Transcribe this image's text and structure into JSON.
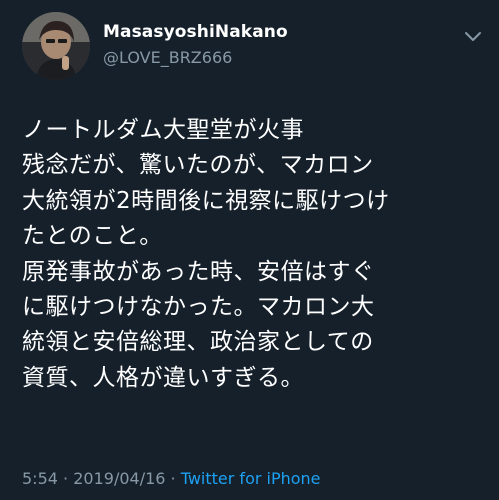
{
  "author": {
    "display_name": "MasasyoshiNakano",
    "handle": "@LOVE_BRZ666"
  },
  "tweet": {
    "lines": [
      "ノートルダム大聖堂が火事",
      "残念だが、驚いたのが、マカロン",
      "大統領が2時間後に視察に駆けつけ",
      "たとのこと。",
      "原発事故があった時、安倍はすぐ",
      "に駆けつけなかった。マカロン大",
      "統領と安倍総理、政治家としての",
      "資質、人格が違いすぎる。"
    ]
  },
  "meta": {
    "time": "5:54",
    "separator": "·",
    "date": "2019/04/16",
    "source": "Twitter for iPhone"
  },
  "icons": {
    "menu": "chevron-down-icon",
    "avatar": "profile-photo"
  },
  "colors": {
    "background": "#15202b",
    "secondary_text": "#8899a6",
    "link": "#1da1f2"
  }
}
